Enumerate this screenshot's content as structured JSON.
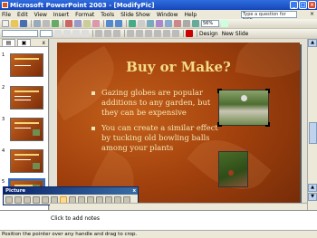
{
  "window": {
    "title": "Microsoft PowerPoint 2003 - [ModifyPic]"
  },
  "menu": [
    "File",
    "Edit",
    "View",
    "Insert",
    "Format",
    "Tools",
    "Slide Show",
    "Window",
    "Help"
  ],
  "help_box": {
    "placeholder": "Type a question for help"
  },
  "toolbar": {
    "zoom": "56%",
    "design_label": "Design",
    "new_slide_label": "New Slide"
  },
  "outline_tabs": {
    "outline": "▤",
    "slides": "▣",
    "close": "x"
  },
  "slides": [
    {
      "number": "1"
    },
    {
      "number": "2"
    },
    {
      "number": "3"
    },
    {
      "number": "4"
    },
    {
      "number": "5"
    }
  ],
  "slide": {
    "title": "Buy or Make?",
    "bullets": [
      "Gazing globes are popular additions to any garden, but they can be expensive",
      "You can create a similar effect by tucking old bowling balls among your plants"
    ]
  },
  "picture_toolbar": {
    "title": "Picture",
    "close": "x"
  },
  "notes": {
    "placeholder": "Click to add notes"
  },
  "status": {
    "text": "Position the pointer over any handle and drag to crop."
  },
  "colors": {
    "titlebar": "#1747b8",
    "slide_background": "#a2410d",
    "slide_title": "#f3dc87"
  }
}
